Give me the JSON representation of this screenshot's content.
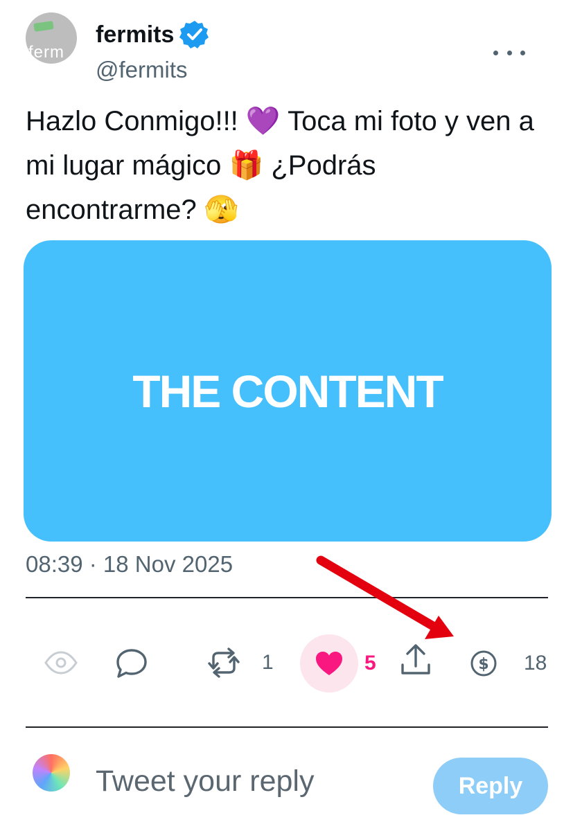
{
  "author": {
    "name": "fermits",
    "handle": "@fermits",
    "verified": true,
    "avatar_text": "ferm"
  },
  "tweet": {
    "text": "Hazlo Conmigo!!! 💜 Toca mi foto y ven a mi lugar mágico 🎁 ¿Podrás encontrarme? 🫣",
    "media_text": "THE CONTENT",
    "timestamp": "08:39 · 18 Nov 2025"
  },
  "actions": {
    "views_icon": "eye-icon",
    "reply_icon": "speech-bubble-icon",
    "retweet_icon": "retweet-icon",
    "retweet_count": "1",
    "like_icon": "heart-icon",
    "like_count": "5",
    "liked": true,
    "share_icon": "share-upload-icon",
    "tip_icon": "dollar-circle-icon",
    "tip_count": "18"
  },
  "composer": {
    "placeholder": "Tweet your reply",
    "value": "",
    "reply_button": "Reply"
  },
  "colors": {
    "brand": "#1d9bf0",
    "media_bg": "#46c0fd",
    "like": "#f91880",
    "like_bg": "#fde5ee",
    "reply_button_bg": "#8ecdf7",
    "annotation_arrow": "#e3000f",
    "secondary_text": "#536471"
  }
}
